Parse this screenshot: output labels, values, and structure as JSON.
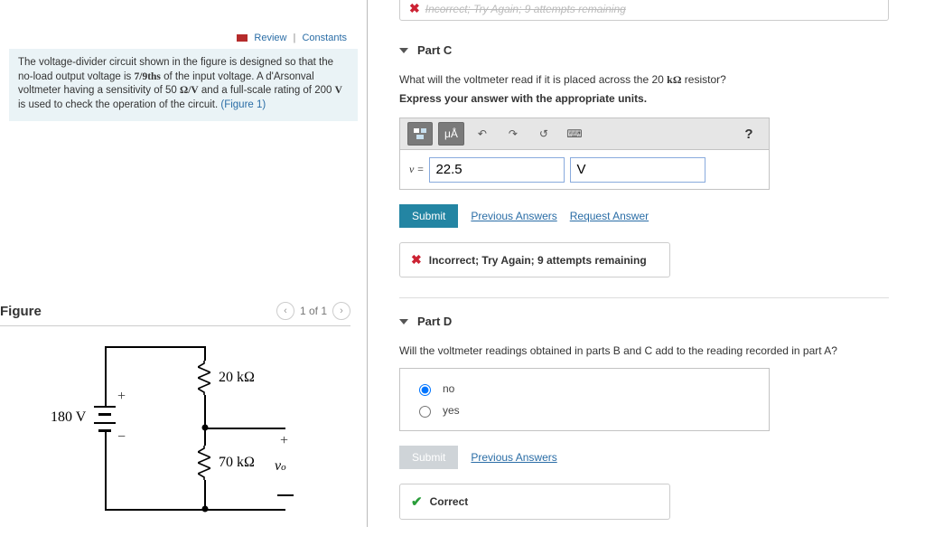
{
  "review": {
    "review_label": "Review",
    "constants_label": "Constants"
  },
  "problem": {
    "text_pre": "The voltage-divider circuit shown in the figure is designed so that the no-load output voltage is ",
    "frac": "7/9ths",
    "text_mid": " of the input voltage. A d'Arsonval voltmeter having a sensitivity of 50 ",
    "ohmv": "Ω/V",
    "text_mid2": " and a full-scale rating of 200 ",
    "V": "V",
    "text_after": " is used to check the operation of the circuit. ",
    "figure_link": "(Figure 1)"
  },
  "figure": {
    "title": "Figure",
    "page": "1 of 1",
    "source_label": "180 V",
    "r1_label": "20 kΩ",
    "r2_label": "70 kΩ",
    "vo_label": "v",
    "vo_sub": "o"
  },
  "partC": {
    "title": "Part C",
    "question_pre": "What will the voltmeter read if it is placed across the 20 ",
    "kohm": "kΩ",
    "question_post": " resistor?",
    "instruction": "Express your answer with the appropriate units.",
    "equals": "v =",
    "answer_value": "22.5",
    "unit_value": "V",
    "toolbar": {
      "mu_a": "μÅ",
      "undo": "↶",
      "redo": "↷",
      "reset": "↺",
      "keyboard": "⌨",
      "help": "?"
    },
    "submit": "Submit",
    "prev": "Previous Answers",
    "req": "Request Answer",
    "feedback_bold": "Incorrect; Try Again; 9 attempts remaining"
  },
  "topClip": {
    "text": "Incorrect; Try Again; 9 attempts remaining"
  },
  "partD": {
    "title": "Part D",
    "question": "Will the voltmeter readings obtained in parts B and C add to the reading recorded in part A?",
    "opt_no": "no",
    "opt_yes": "yes",
    "submit": "Submit",
    "prev": "Previous Answers",
    "feedback": "Correct"
  },
  "chart_data": {
    "type": "diagram",
    "description": "Voltage-divider circuit",
    "source_voltage_V": 180,
    "resistors_kohm": {
      "R1": 20,
      "R2": 70
    },
    "output_node": "v_o"
  }
}
